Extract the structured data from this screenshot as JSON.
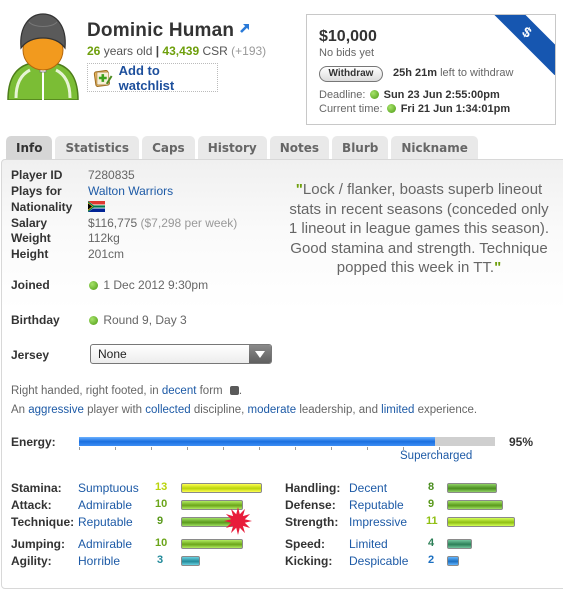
{
  "player": {
    "name": "Dominic Human",
    "age": "26",
    "age_suffix": " years old ",
    "separator": "|",
    "csr": "43,439",
    "csr_label": " CSR ",
    "csr_change": "(+193)",
    "watchlist_label": "Add to watchlist",
    "icons": {
      "avatar": "player-avatar",
      "external_link": "external-link-icon",
      "watchlist": "watchlist-add-icon"
    }
  },
  "transfer": {
    "price": "$10,000",
    "bids_status": "No bids yet",
    "withdraw_label": "Withdraw",
    "withdraw_time": "25h 21m",
    "withdraw_suffix": " left to withdraw",
    "deadline_label": "Deadline: ",
    "deadline": "Sun 23 Jun 2:55:00pm",
    "current_label": "Current time: ",
    "current": "Fri 21 Jun 1:34:01pm",
    "ribbon_symbol": "$"
  },
  "tabs": [
    {
      "label": "Info",
      "active": true
    },
    {
      "label": "Statistics",
      "active": false
    },
    {
      "label": "Caps",
      "active": false
    },
    {
      "label": "History",
      "active": false
    },
    {
      "label": "Notes",
      "active": false
    },
    {
      "label": "Blurb",
      "active": false
    },
    {
      "label": "Nickname",
      "active": false
    }
  ],
  "info": {
    "player_id_label": "Player ID",
    "player_id": "7280835",
    "plays_for_label": "Plays for",
    "plays_for": "Walton Warriors",
    "nationality_label": "Nationality",
    "nationality_flag": "south-africa-flag",
    "salary_label": "Salary",
    "salary": "$116,775",
    "salary_weekly": "($7,298 per week)",
    "weight_label": "Weight",
    "weight": "112kg",
    "height_label": "Height",
    "height": "201cm",
    "joined_label": "Joined",
    "joined": "1 Dec 2012 9:30pm",
    "birthday_label": "Birthday",
    "birthday": "Round 9, Day 3",
    "jersey_label": "Jersey",
    "jersey_value": "None"
  },
  "quote": {
    "open": "\"",
    "text": "Lock / flanker, boasts superb lineout stats in recent seasons (conceded only 1 lineout in league games this season). Good stamina and strength. Technique popped this week in TT.",
    "close": "\""
  },
  "traits": {
    "line1_a": "Right handed, right footed, in ",
    "form": "decent",
    "line1_b": " form ",
    "line1_end": ".",
    "line2_a": "An ",
    "aggression": "aggressive",
    "line2_b": " player with ",
    "discipline": "collected",
    "line2_c": " discipline, ",
    "leadership": "moderate",
    "line2_d": " leadership, and ",
    "experience": "limited",
    "line2_e": " experience."
  },
  "energy": {
    "label": "Energy:",
    "percent": 95,
    "value_text": "95%",
    "description": "Supercharged",
    "fill_color": "#1a6fe0"
  },
  "skills": {
    "left": [
      {
        "label": "Stamina:",
        "desc": "Sumptuous",
        "value": 13,
        "color": "#b9d40a"
      },
      {
        "label": "Attack:",
        "desc": "Admirable",
        "value": 10,
        "color": "#6ba51a"
      },
      {
        "label": "Technique:",
        "desc": "Reputable",
        "value": 9,
        "color": "#5a9a1c",
        "popped": true
      },
      {
        "label": "Jumping:",
        "desc": "Admirable",
        "value": 10,
        "color": "#6ba51a"
      },
      {
        "label": "Agility:",
        "desc": "Horrible",
        "value": 3,
        "color": "#238a9a"
      }
    ],
    "right": [
      {
        "label": "Handling:",
        "desc": "Decent",
        "value": 8,
        "color": "#4a8d1f"
      },
      {
        "label": "Defense:",
        "desc": "Reputable",
        "value": 9,
        "color": "#5a9a1c"
      },
      {
        "label": "Strength:",
        "desc": "Impressive",
        "value": 11,
        "color": "#8fbf12"
      },
      {
        "label": "Speed:",
        "desc": "Limited",
        "value": 4,
        "color": "#2c7f57"
      },
      {
        "label": "Kicking:",
        "desc": "Despicable",
        "value": 2,
        "color": "#1c6fc0"
      }
    ],
    "max_value": 20
  }
}
